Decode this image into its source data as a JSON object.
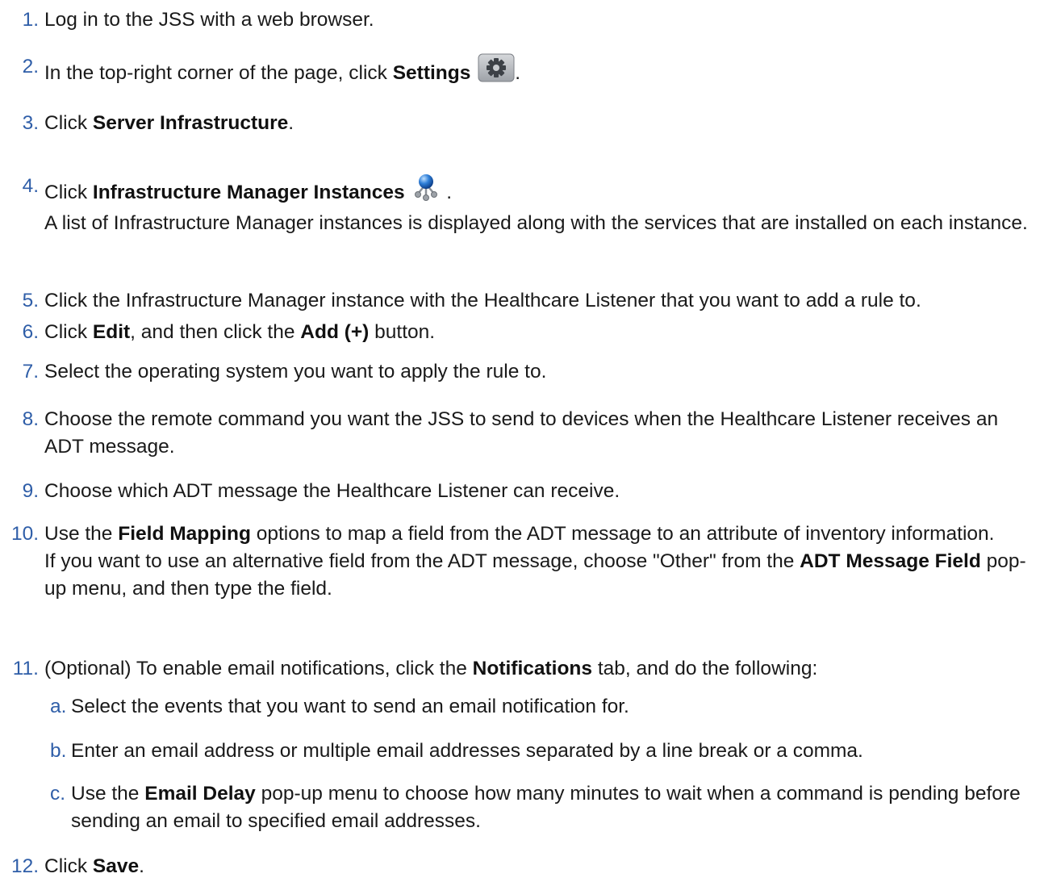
{
  "steps": [
    {
      "num": "1.",
      "parts": [
        {
          "t": "Log in to the JSS with a web browser."
        }
      ]
    },
    {
      "num": "2.",
      "parts": [
        {
          "t": "In the top-right corner of the page, click "
        },
        {
          "b": "Settings"
        },
        {
          "icon": "gear-icon"
        },
        {
          "t": "."
        }
      ]
    },
    {
      "num": "3.",
      "parts": [
        {
          "t": "Click "
        },
        {
          "b": "Server Infrastructure"
        },
        {
          "t": "."
        }
      ]
    },
    {
      "num": "4.",
      "parts": [
        {
          "t": "Click "
        },
        {
          "b": "Infrastructure Manager Instances"
        },
        {
          "icon": "network-node-icon"
        },
        {
          "t": "."
        }
      ],
      "note": "A list of Infrastructure Manager instances is displayed along with the services that are installed on each instance."
    },
    {
      "num": "5.",
      "parts": [
        {
          "t": "Click the Infrastructure Manager instance with the Healthcare Listener that you want to add a rule to."
        }
      ]
    },
    {
      "num": "6.",
      "parts": [
        {
          "t": "Click "
        },
        {
          "b": "Edit"
        },
        {
          "t": ", and then click the "
        },
        {
          "b": "Add (+)"
        },
        {
          "t": " button."
        }
      ]
    },
    {
      "num": "7.",
      "parts": [
        {
          "t": "Select the operating system you want to apply the rule to."
        }
      ]
    },
    {
      "num": "8.",
      "parts": [
        {
          "t": "Choose the remote command you want the JSS to send to devices when the Healthcare Listener receives an ADT message."
        }
      ]
    },
    {
      "num": "9.",
      "parts": [
        {
          "t": "Choose which ADT message the Healthcare Listener can receive."
        }
      ]
    },
    {
      "num": "10.",
      "parts": [
        {
          "t": "Use the "
        },
        {
          "b": "Field Mapping"
        },
        {
          "t": " options to map a field from the ADT message to an attribute of inventory information."
        }
      ],
      "note_parts": [
        {
          "t": "If you want to use an alternative field from the ADT message, choose \"Other\" from the "
        },
        {
          "b": "ADT Message Field"
        },
        {
          "t": " pop-up menu, and then type the field."
        }
      ]
    },
    {
      "num": "11.",
      "parts": [
        {
          "t": "(Optional) To enable email notifications, click the "
        },
        {
          "b": "Notifications"
        },
        {
          "t": " tab, and do the following:"
        }
      ],
      "substeps": [
        {
          "letter": "a.",
          "parts": [
            {
              "t": "Select the events that you want to send an email notification for."
            }
          ]
        },
        {
          "letter": "b.",
          "parts": [
            {
              "t": "Enter an email address or multiple email addresses separated by a line break or a comma."
            }
          ]
        },
        {
          "letter": "c.",
          "parts": [
            {
              "t": "Use the "
            },
            {
              "b": "Email Delay"
            },
            {
              "t": " pop-up menu to choose how many minutes to wait when a command is pending before sending an email to specified email addresses."
            }
          ]
        }
      ]
    },
    {
      "num": "12.",
      "parts": [
        {
          "t": "Click "
        },
        {
          "b": "Save"
        },
        {
          "t": "."
        }
      ]
    }
  ],
  "colors": {
    "number": "#2f5ea8",
    "text": "#1a1a1a"
  }
}
